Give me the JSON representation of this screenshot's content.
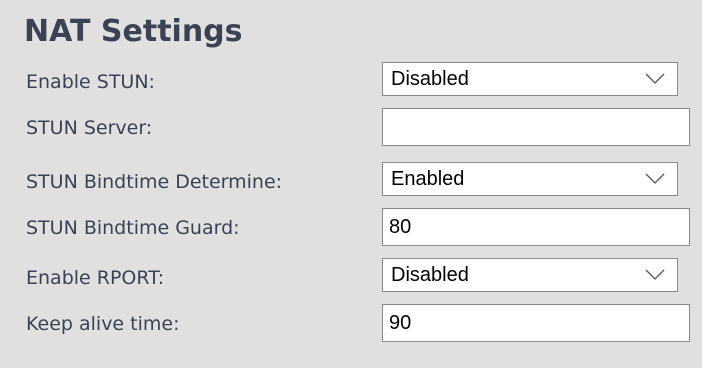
{
  "section": {
    "title": "NAT Settings"
  },
  "fields": {
    "enable_stun": {
      "label": "Enable STUN:",
      "value": "Disabled"
    },
    "stun_server": {
      "label": "STUN Server:",
      "value": ""
    },
    "stun_bindtime_determine": {
      "label": "STUN Bindtime Determine:",
      "value": "Enabled"
    },
    "stun_bindtime_guard": {
      "label": "STUN Bindtime Guard:",
      "value": "80"
    },
    "enable_rport": {
      "label": "Enable RPORT:",
      "value": "Disabled"
    },
    "keep_alive_time": {
      "label": "Keep alive time:",
      "value": "90"
    }
  },
  "icons": {
    "dropdown": "chevron-down-icon"
  },
  "colors": {
    "panel_background": "#e0e0e0",
    "text": "#3a4254",
    "field_border": "#8a8a8a"
  }
}
